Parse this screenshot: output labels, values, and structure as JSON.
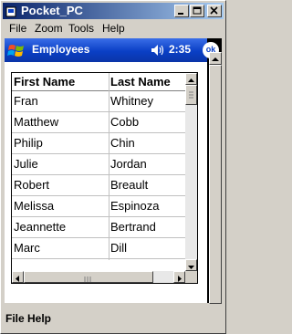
{
  "window": {
    "title": "Pocket_PC",
    "controls": [
      "minimize",
      "maximize",
      "close"
    ]
  },
  "menubar": {
    "items": [
      {
        "label": "File"
      },
      {
        "label": "Zoom"
      },
      {
        "label": "Tools"
      },
      {
        "label": "Help"
      }
    ]
  },
  "navbar": {
    "title": "Employees",
    "time": "2:35",
    "ok_label": "ok",
    "start_icon": "windows-flag-icon",
    "volume_icon": "speaker-icon"
  },
  "grid": {
    "columns": [
      "First Name",
      "Last Name"
    ],
    "rows": [
      [
        "Fran",
        "Whitney"
      ],
      [
        "Matthew",
        "Cobb"
      ],
      [
        "Philip",
        "Chin"
      ],
      [
        "Julie",
        "Jordan"
      ],
      [
        "Robert",
        "Breault"
      ],
      [
        "Melissa",
        "Espinoza"
      ],
      [
        "Jeannette",
        "Bertrand"
      ],
      [
        "Marc",
        "Dill"
      ]
    ]
  },
  "bottom_menu": {
    "items": [
      {
        "label": "File"
      },
      {
        "label": "Help"
      }
    ]
  },
  "colors": {
    "nav_blue": "#0a3fc5",
    "titlebar": "#0a246a",
    "chrome": "#d4d0c8"
  }
}
